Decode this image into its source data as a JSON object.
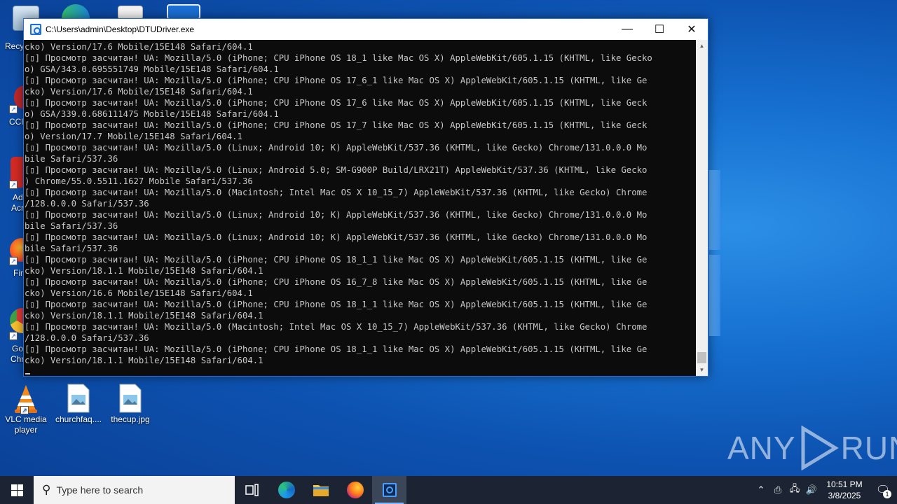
{
  "desktop": {
    "icons": [
      {
        "label": "Recycle Bin"
      },
      {
        "label": "VLC media player"
      },
      {
        "label": "churchfaq...."
      },
      {
        "label": "thecup.jpg"
      }
    ],
    "partial_labels": [
      "Recyc",
      "CCl",
      "Ad",
      "Acr",
      "Fir",
      "Go",
      "Chr"
    ]
  },
  "window": {
    "title": "C:\\Users\\admin\\Desktop\\DTUDriver.exe",
    "controls": {
      "minimize": "—",
      "maximize": "☐",
      "close": "✕"
    },
    "console_lines": [
      "cko) Version/17.6 Mobile/15E148 Safari/604.1",
      "[▯] Просмотр засчитан! UA: Mozilla/5.0 (iPhone; CPU iPhone OS 18_1 like Mac OS X) AppleWebKit/605.1.15 (KHTML, like Gecko",
      "o) GSA/343.0.695551749 Mobile/15E148 Safari/604.1",
      "[▯] Просмотр засчитан! UA: Mozilla/5.0 (iPhone; CPU iPhone OS 17_6_1 like Mac OS X) AppleWebKit/605.1.15 (KHTML, like Ge",
      "cko) Version/17.6 Mobile/15E148 Safari/604.1",
      "[▯] Просмотр засчитан! UA: Mozilla/5.0 (iPhone; CPU iPhone OS 17_6 like Mac OS X) AppleWebKit/605.1.15 (KHTML, like Geck",
      "o) GSA/339.0.686111475 Mobile/15E148 Safari/604.1",
      "[▯] Просмотр засчитан! UA: Mozilla/5.0 (iPhone; CPU iPhone OS 17_7 like Mac OS X) AppleWebKit/605.1.15 (KHTML, like Geck",
      "o) Version/17.7 Mobile/15E148 Safari/604.1",
      "[▯] Просмотр засчитан! UA: Mozilla/5.0 (Linux; Android 10; K) AppleWebKit/537.36 (KHTML, like Gecko) Chrome/131.0.0.0 Mo",
      "bile Safari/537.36",
      "[▯] Просмотр засчитан! UA: Mozilla/5.0 (Linux; Android 5.0; SM-G900P Build/LRX21T) AppleWebKit/537.36 (KHTML, like Gecko",
      ") Chrome/55.0.5511.1627 Mobile Safari/537.36",
      "[▯] Просмотр засчитан! UA: Mozilla/5.0 (Macintosh; Intel Mac OS X 10_15_7) AppleWebKit/537.36 (KHTML, like Gecko) Chrome",
      "/128.0.0.0 Safari/537.36",
      "[▯] Просмотр засчитан! UA: Mozilla/5.0 (Linux; Android 10; K) AppleWebKit/537.36 (KHTML, like Gecko) Chrome/131.0.0.0 Mo",
      "bile Safari/537.36",
      "[▯] Просмотр засчитан! UA: Mozilla/5.0 (Linux; Android 10; K) AppleWebKit/537.36 (KHTML, like Gecko) Chrome/131.0.0.0 Mo",
      "bile Safari/537.36",
      "[▯] Просмотр засчитан! UA: Mozilla/5.0 (iPhone; CPU iPhone OS 18_1_1 like Mac OS X) AppleWebKit/605.1.15 (KHTML, like Ge",
      "cko) Version/18.1.1 Mobile/15E148 Safari/604.1",
      "[▯] Просмотр засчитан! UA: Mozilla/5.0 (iPhone; CPU iPhone OS 16_7_8 like Mac OS X) AppleWebKit/605.1.15 (KHTML, like Ge",
      "cko) Version/16.6 Mobile/15E148 Safari/604.1",
      "[▯] Просмотр засчитан! UA: Mozilla/5.0 (iPhone; CPU iPhone OS 18_1_1 like Mac OS X) AppleWebKit/605.1.15 (KHTML, like Ge",
      "cko) Version/18.1.1 Mobile/15E148 Safari/604.1",
      "[▯] Просмотр засчитан! UA: Mozilla/5.0 (Macintosh; Intel Mac OS X 10_15_7) AppleWebKit/537.36 (KHTML, like Gecko) Chrome",
      "/128.0.0.0 Safari/537.36",
      "[▯] Просмотр засчитан! UA: Mozilla/5.0 (iPhone; CPU iPhone OS 18_1_1 like Mac OS X) AppleWebKit/605.1.15 (KHTML, like Ge",
      "cko) Version/18.1.1 Mobile/15E148 Safari/604.1"
    ]
  },
  "taskbar": {
    "search_placeholder": "Type here to search",
    "clock_time": "10:51 PM",
    "clock_date": "3/8/2025",
    "notification_count": "1"
  },
  "watermark": {
    "text_left": "ANY",
    "text_right": "RUN"
  },
  "colors": {
    "console_bg": "#0c0c0c",
    "console_text": "#c8c8c8",
    "taskbar_bg": "#1c2433",
    "accent": "#1b6fd6"
  }
}
